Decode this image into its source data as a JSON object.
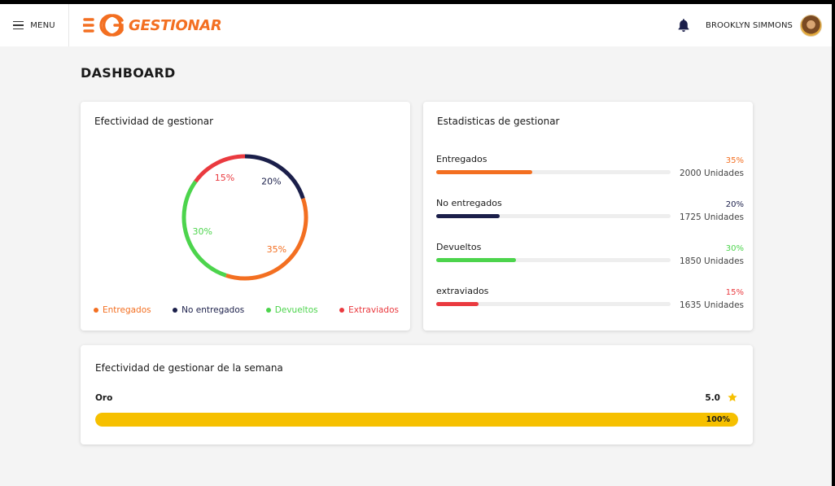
{
  "header": {
    "menu_label": "MENU",
    "logo_text": "GESTIONAR",
    "user_name": "BROOKLYN SIMMONS",
    "icons": [
      "menu-icon",
      "bell-icon"
    ]
  },
  "page": {
    "title": "DASHBOARD"
  },
  "colors": {
    "entregados": "#f36f21",
    "no_entregados": "#1b1f4a",
    "devueltos": "#4cd44c",
    "extraviados": "#ea3a3f",
    "gold": "#f6c000"
  },
  "donut_card": {
    "title": "Efectividad de gestionar",
    "segments": [
      {
        "key": "entregados",
        "label": "Entregados",
        "percent": 35,
        "text": "35%",
        "color": "#f36f21"
      },
      {
        "key": "no_entregados",
        "label": "No entregados",
        "percent": 20,
        "text": "20%",
        "color": "#1b1f4a"
      },
      {
        "key": "devueltos",
        "label": "Devueltos",
        "percent": 30,
        "text": "30%",
        "color": "#4cd44c"
      },
      {
        "key": "extraviados",
        "label": "Extraviados",
        "percent": 15,
        "text": "15%",
        "color": "#ea3a3f"
      }
    ]
  },
  "stats_card": {
    "title": "Estadisticas de gestionar",
    "rows": [
      {
        "label": "Entregados",
        "percent": 35,
        "text": "35%",
        "units": "2000 Unidades",
        "color": "#f36f21",
        "fill_fraction": 0.41
      },
      {
        "label": "No entregados",
        "percent": 20,
        "text": "20%",
        "units": "1725 Unidades",
        "color": "#1b1f4a",
        "fill_fraction": 0.27
      },
      {
        "label": "Devueltos",
        "percent": 30,
        "text": "30%",
        "units": "1850 Unidades",
        "color": "#4cd44c",
        "fill_fraction": 0.34
      },
      {
        "label": "extraviados",
        "percent": 15,
        "text": "15%",
        "units": "1635 Unidades",
        "color": "#ea3a3f",
        "fill_fraction": 0.18
      }
    ]
  },
  "week_card": {
    "title": "Efectividad de gestionar de la semana",
    "level": "Oro",
    "score": "5.0",
    "progress_text": "100%",
    "progress_fraction": 1.0
  }
}
